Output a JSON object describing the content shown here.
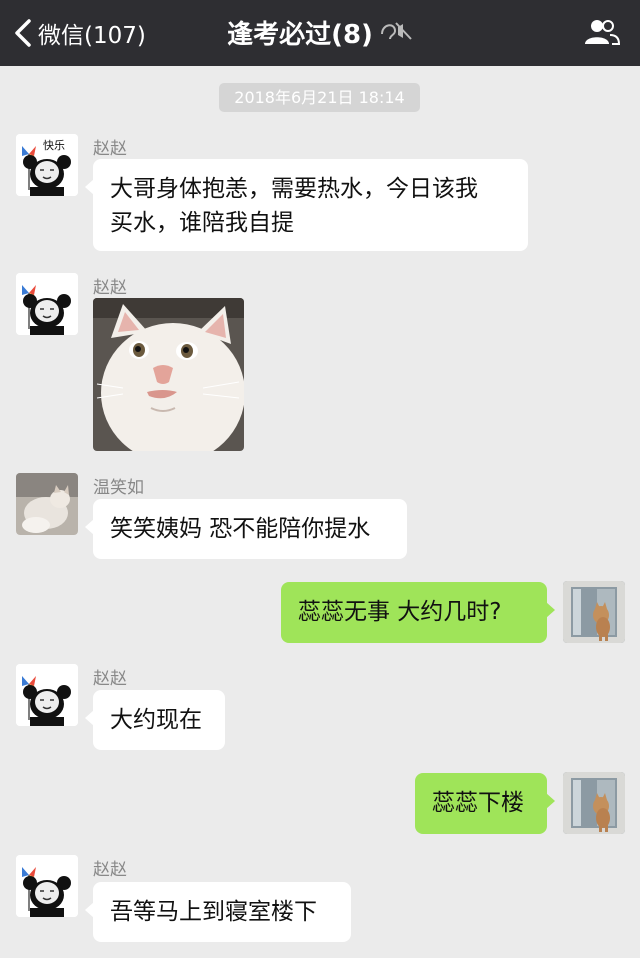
{
  "nav": {
    "back_label": "微信(107)",
    "title": "逢考必过(8)",
    "bar_color": "#2e2e32"
  },
  "timestamp": "2018年6月21日 18:14",
  "avatar_text": "快乐",
  "messages": [
    {
      "side": "left",
      "sender": "赵赵",
      "type": "text",
      "lines": [
        "大哥身体抱恙，需要热水，今日该我",
        "买水，谁陪我自提"
      ]
    },
    {
      "side": "left",
      "sender": "赵赵",
      "type": "image",
      "image": "cat-face-sticker"
    },
    {
      "side": "left",
      "sender": "温笑如",
      "type": "text",
      "lines": [
        "笑笑姨妈 恐不能陪你提水"
      ]
    },
    {
      "side": "right",
      "type": "text",
      "lines": [
        "蕊蕊无事 大约几时?"
      ]
    },
    {
      "side": "left",
      "sender": "赵赵",
      "type": "text",
      "lines": [
        "大约现在"
      ]
    },
    {
      "side": "right",
      "type": "text",
      "lines": [
        "蕊蕊下楼"
      ]
    },
    {
      "side": "left",
      "sender": "赵赵",
      "type": "text",
      "lines": [
        "吾等马上到寝室楼下"
      ]
    }
  ],
  "colors": {
    "background": "#ebebeb",
    "self_bubble": "#9fe459",
    "other_bubble": "#ffffff"
  }
}
